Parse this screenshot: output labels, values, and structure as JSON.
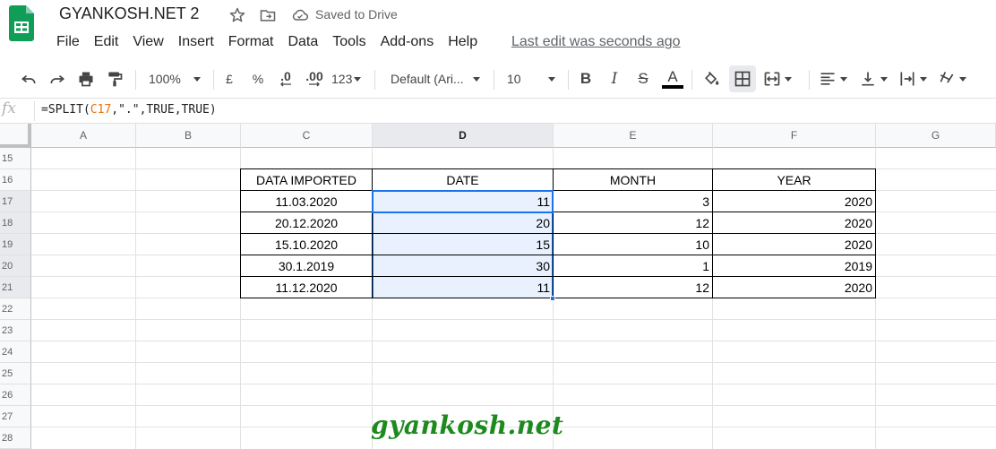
{
  "header": {
    "title": "GYANKOSH.NET 2",
    "saved_status": "Saved to Drive",
    "last_edit": "Last edit was seconds ago",
    "menu": [
      "File",
      "Edit",
      "View",
      "Insert",
      "Format",
      "Data",
      "Tools",
      "Add-ons",
      "Help"
    ]
  },
  "toolbar": {
    "zoom": "100%",
    "currency": "£",
    "percent": "%",
    "dec_decrease": ".0",
    "dec_increase": ".00",
    "more_formats": "123",
    "font": "Default (Ari...",
    "font_size": "10",
    "bold": "B",
    "italic": "I",
    "strike": "S",
    "text_color_letter": "A",
    "text_color": "#000000"
  },
  "formula_bar": {
    "fx": "fx",
    "formula_prefix": "=SPLIT(",
    "formula_ref": "C17",
    "formula_suffix": ",\".\",TRUE,TRUE)"
  },
  "grid": {
    "columns": [
      "A",
      "B",
      "C",
      "D",
      "E",
      "F",
      "G"
    ],
    "selected_column": "D",
    "rows": [
      "15",
      "16",
      "17",
      "18",
      "19",
      "20",
      "21",
      "22",
      "23",
      "24",
      "25",
      "26",
      "27",
      "28"
    ],
    "table": {
      "headers": [
        "DATA IMPORTED",
        "DATE",
        "MONTH",
        "YEAR"
      ],
      "rows": [
        [
          "11.03.2020",
          "11",
          "3",
          "2020"
        ],
        [
          "20.12.2020",
          "20",
          "12",
          "2020"
        ],
        [
          "15.10.2020",
          "15",
          "10",
          "2020"
        ],
        [
          "30.1.2019",
          "30",
          "1",
          "2019"
        ],
        [
          "11.12.2020",
          "11",
          "12",
          "2020"
        ]
      ]
    }
  },
  "watermark": "gyankosh.net",
  "colors": {
    "accent": "#1a73e8",
    "sheets_green": "#0f9d58",
    "watermark": "#1d8a1d",
    "formula_ref": "#e8710a"
  }
}
